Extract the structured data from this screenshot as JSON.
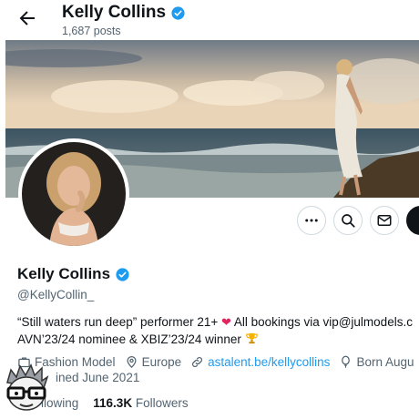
{
  "header": {
    "name": "Kelly Collins",
    "posts": "1,687 posts"
  },
  "profile": {
    "name": "Kelly Collins",
    "handle": "@KellyCollin_",
    "bio_line1_a": "“Still waters run deep” performer 21+",
    "bio_line1_b": "All bookings via vip@julmodels.c",
    "bio_line2": "AVN’23/24 nominee & XBIZ’23/24 winner",
    "category": "Fashion Model",
    "location": "Europe",
    "website": "astalent.be/kellycollins",
    "born": "Born Augu",
    "joined": "ined June 2021",
    "following_label": "llowing",
    "followers_count": "116.3K",
    "followers_label": "Followers"
  },
  "colors": {
    "accent": "#1d9bf0",
    "heart": "#e0245e",
    "text_secondary": "#536471"
  },
  "icons": [
    "back-arrow-icon",
    "verified-badge-icon",
    "more-icon",
    "search-icon",
    "message-icon",
    "briefcase-icon",
    "location-pin-icon",
    "link-icon",
    "balloon-icon",
    "calendar-icon",
    "heart-icon",
    "trophy-icon"
  ]
}
